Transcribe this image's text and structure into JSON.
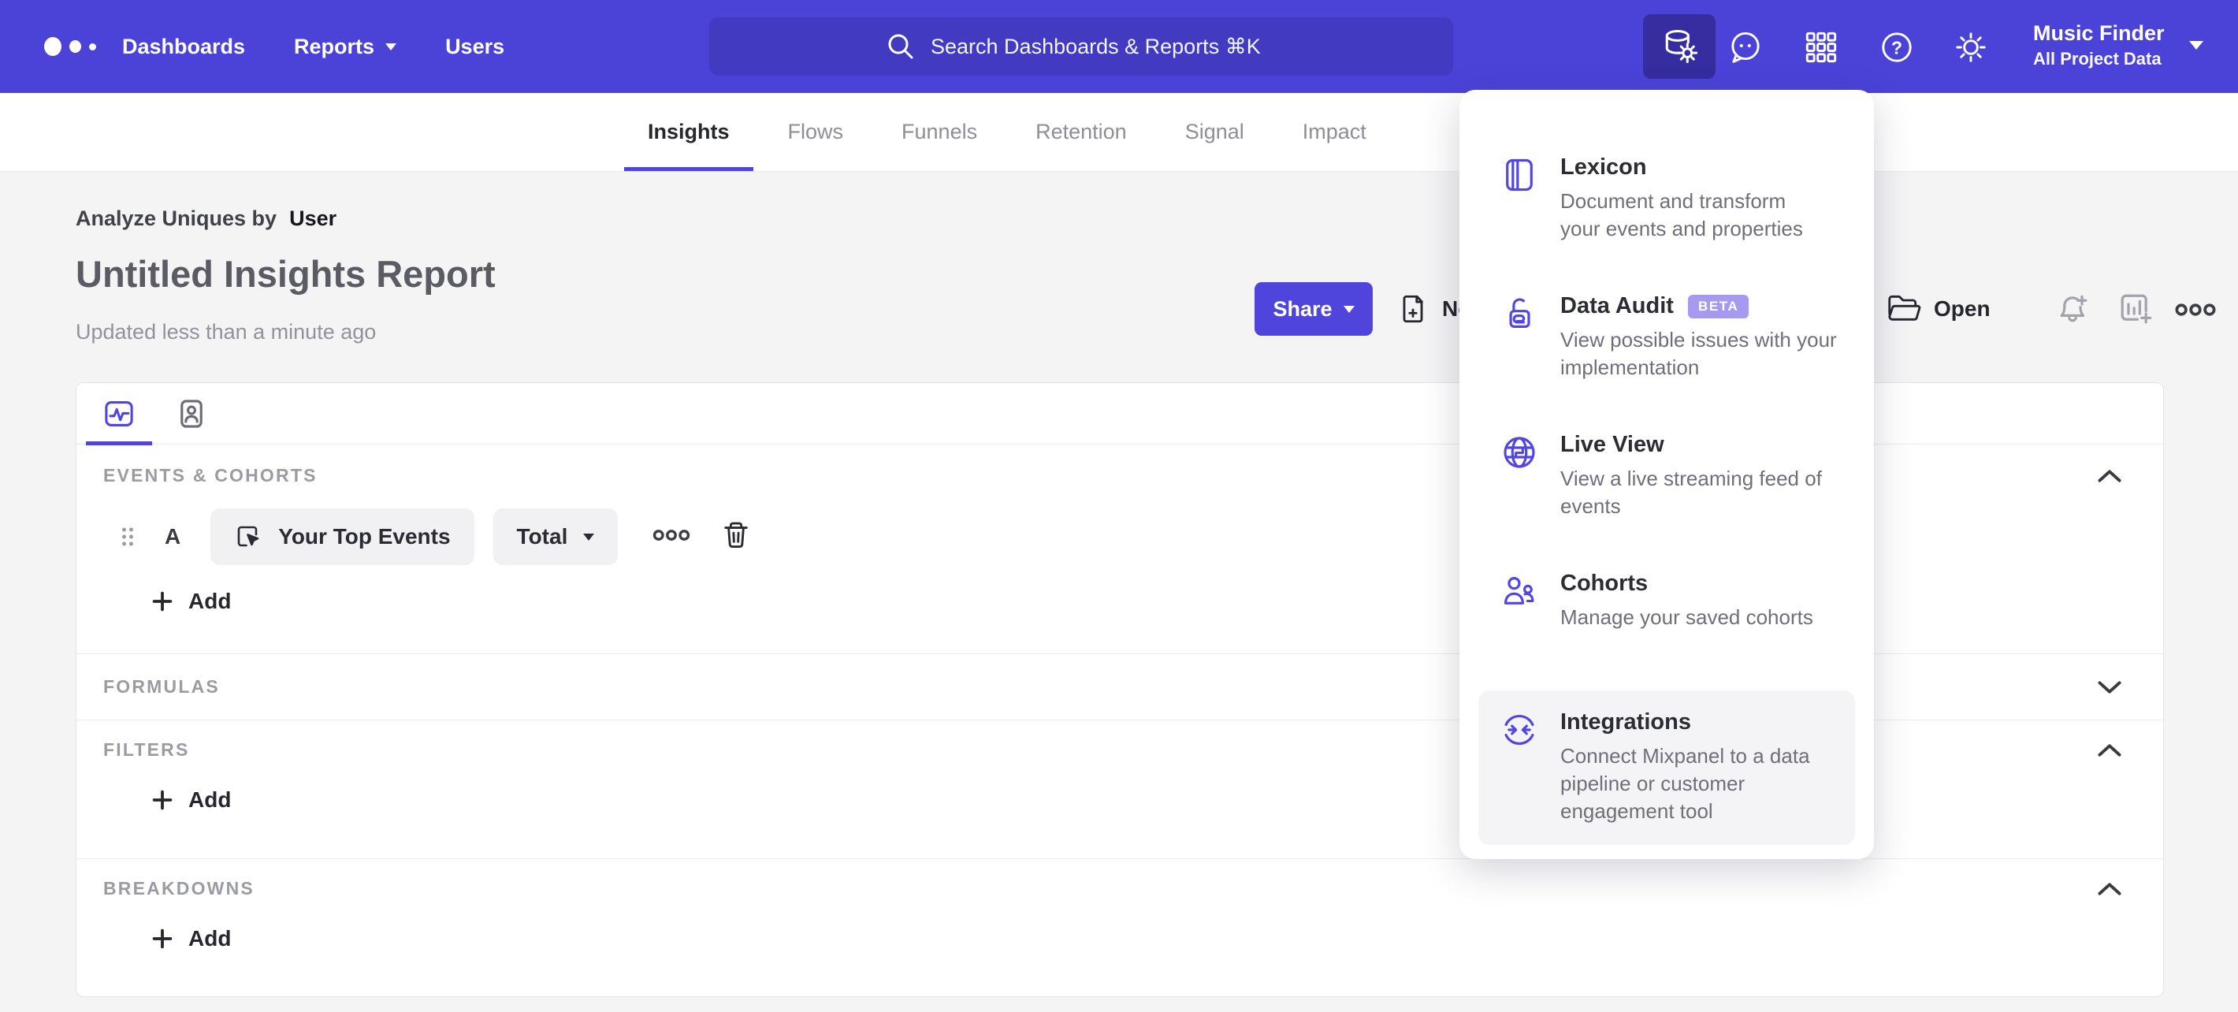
{
  "topbar": {
    "nav": [
      {
        "label": "Dashboards"
      },
      {
        "label": "Reports"
      },
      {
        "label": "Users"
      }
    ],
    "search": {
      "placeholder": "Search Dashboards & Reports ⌘K"
    },
    "project": {
      "name": "Music Finder",
      "scope": "All Project Data"
    }
  },
  "tabs": [
    {
      "label": "Insights",
      "active": true
    },
    {
      "label": "Flows"
    },
    {
      "label": "Funnels"
    },
    {
      "label": "Retention"
    },
    {
      "label": "Signal"
    },
    {
      "label": "Impact"
    }
  ],
  "report": {
    "analyze_prefix": "Analyze Uniques by",
    "analyze_value": "User",
    "title": "Untitled Insights Report",
    "updated": "Updated less than a minute ago"
  },
  "actions": {
    "share": "Share",
    "new": "New",
    "open": "Open"
  },
  "builder": {
    "add_label": "Add",
    "event_row": {
      "letter": "A",
      "event": "Your Top Events",
      "aggregation": "Total"
    },
    "sections": [
      {
        "label": "EVENTS & COHORTS",
        "state": "expanded"
      },
      {
        "label": "FORMULAS",
        "state": "collapsed"
      },
      {
        "label": "FILTERS",
        "state": "expanded"
      },
      {
        "label": "BREAKDOWNS",
        "state": "expanded"
      }
    ]
  },
  "tools_menu": {
    "items": [
      {
        "name": "Lexicon",
        "description": "Document and transform your events and properties",
        "icon": "book-icon"
      },
      {
        "name": "Data Audit",
        "badge": "BETA",
        "description": "View possible issues with your implementation",
        "icon": "lock-icon"
      },
      {
        "name": "Live View",
        "description": "View a live streaming feed of events",
        "icon": "globe-icon"
      },
      {
        "name": "Cohorts",
        "description": "Manage your saved cohorts",
        "icon": "people-icon"
      },
      {
        "name": "Integrations",
        "description": "Connect Mixpanel to a data pipeline or customer engagement tool",
        "icon": "sync-arrows-icon",
        "highlighted": true
      }
    ]
  },
  "colors": {
    "brand_bar": "#4b43d8",
    "accent": "#5246e0",
    "search_bg": "#423ac1",
    "active_icon_bg": "#352da0",
    "beta_badge": "#a59af0",
    "page_bg": "#f4f4f5"
  }
}
